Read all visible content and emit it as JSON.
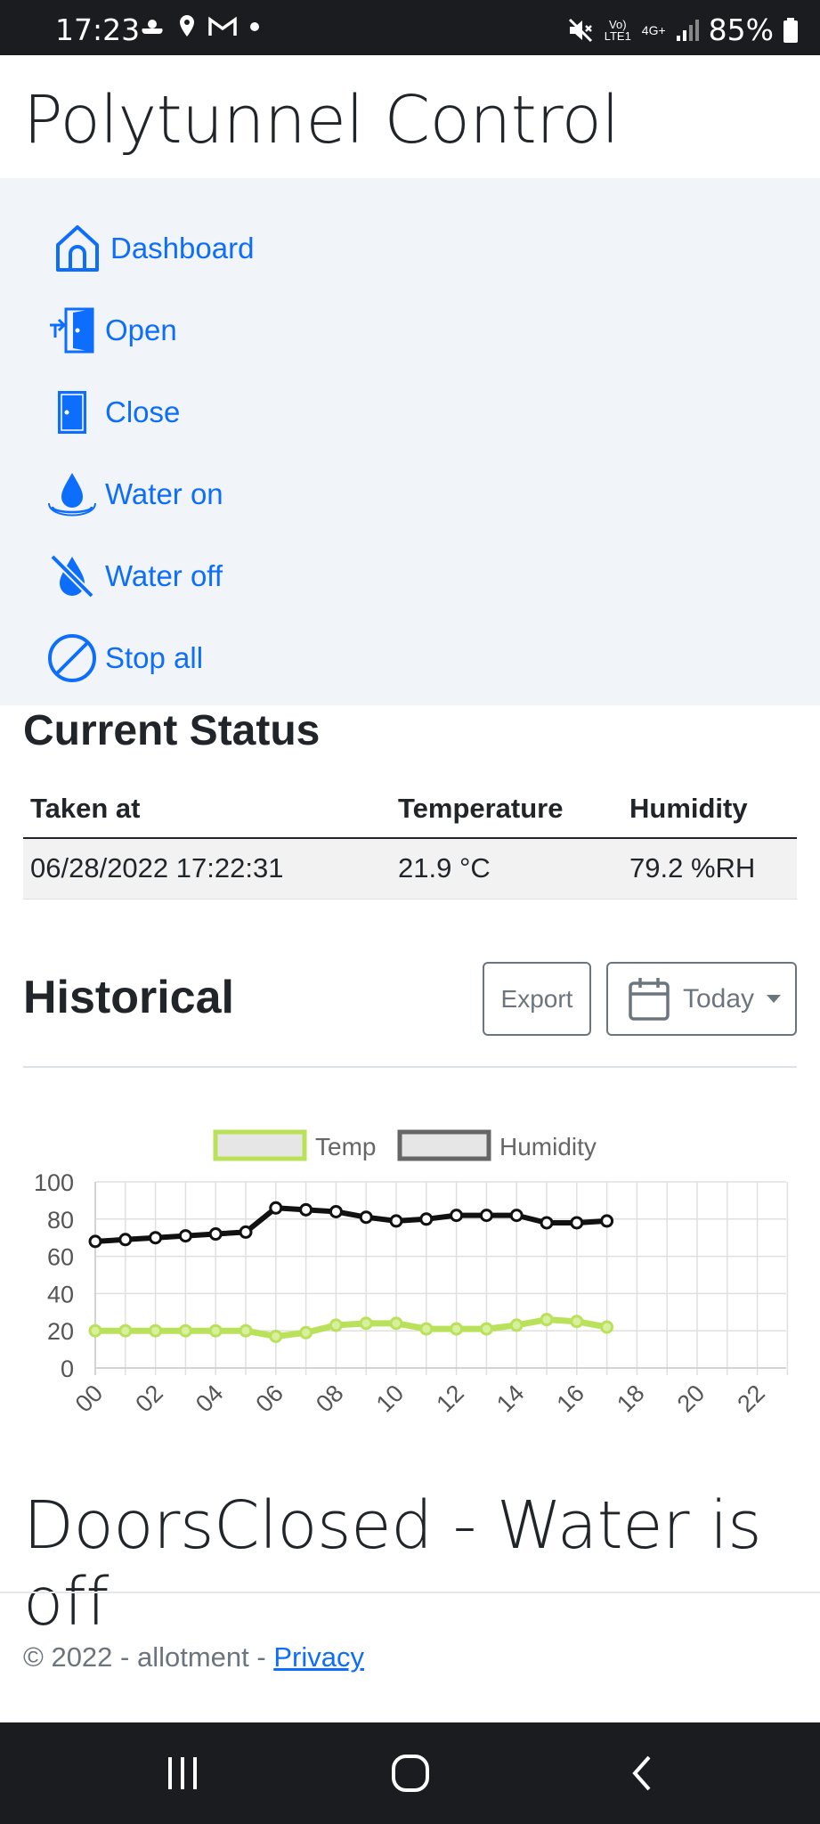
{
  "status_bar": {
    "time": "17:23",
    "battery": "85%",
    "network": "Vo) LTE1",
    "signal_label": "4G+"
  },
  "app": {
    "brand": "Polytunnel Control"
  },
  "nav": {
    "items": [
      {
        "label": "Dashboard",
        "icon": "home-icon"
      },
      {
        "label": "Open",
        "icon": "door-open-icon"
      },
      {
        "label": "Close",
        "icon": "door-closed-icon"
      },
      {
        "label": "Water on",
        "icon": "water-drop-icon"
      },
      {
        "label": "Water off",
        "icon": "water-off-icon"
      },
      {
        "label": "Stop all",
        "icon": "stop-icon"
      }
    ]
  },
  "current_status": {
    "heading": "Current Status",
    "columns": [
      "Taken at",
      "Temperature",
      "Humidity"
    ],
    "row": {
      "taken_at": "06/28/2022 17:22:31",
      "temperature": "21.9 °C",
      "humidity": "79.2 %RH"
    }
  },
  "historical": {
    "heading": "Historical",
    "export_label": "Export",
    "date_label": "Today"
  },
  "chart_data": {
    "type": "line",
    "x": [
      "00",
      "01",
      "02",
      "03",
      "04",
      "05",
      "06",
      "07",
      "08",
      "09",
      "10",
      "11",
      "12",
      "13",
      "14",
      "15",
      "16",
      "17",
      "18",
      "19",
      "20",
      "21",
      "22",
      "23"
    ],
    "x_tick_labels": [
      "00",
      "02",
      "04",
      "06",
      "08",
      "10",
      "12",
      "14",
      "16",
      "18",
      "20",
      "22"
    ],
    "ylim": [
      0,
      100
    ],
    "y_ticks": [
      0,
      20,
      40,
      60,
      80,
      100
    ],
    "legend_position": "top",
    "grid": true,
    "series": [
      {
        "name": "Temp",
        "color": "#b9e25a",
        "values": [
          20,
          20,
          20,
          20,
          20,
          20,
          17,
          19,
          23,
          24,
          24,
          21,
          21,
          21,
          23,
          26,
          25,
          22
        ]
      },
      {
        "name": "Humidity",
        "color": "#111111",
        "values": [
          68,
          69,
          70,
          71,
          72,
          73,
          86,
          85,
          84,
          81,
          79,
          80,
          82,
          82,
          82,
          78,
          78,
          79
        ]
      }
    ]
  },
  "door_status": "DoorsClosed - Water is off",
  "footer": {
    "text": "© 2022 - allotment - ",
    "privacy_label": "Privacy"
  }
}
